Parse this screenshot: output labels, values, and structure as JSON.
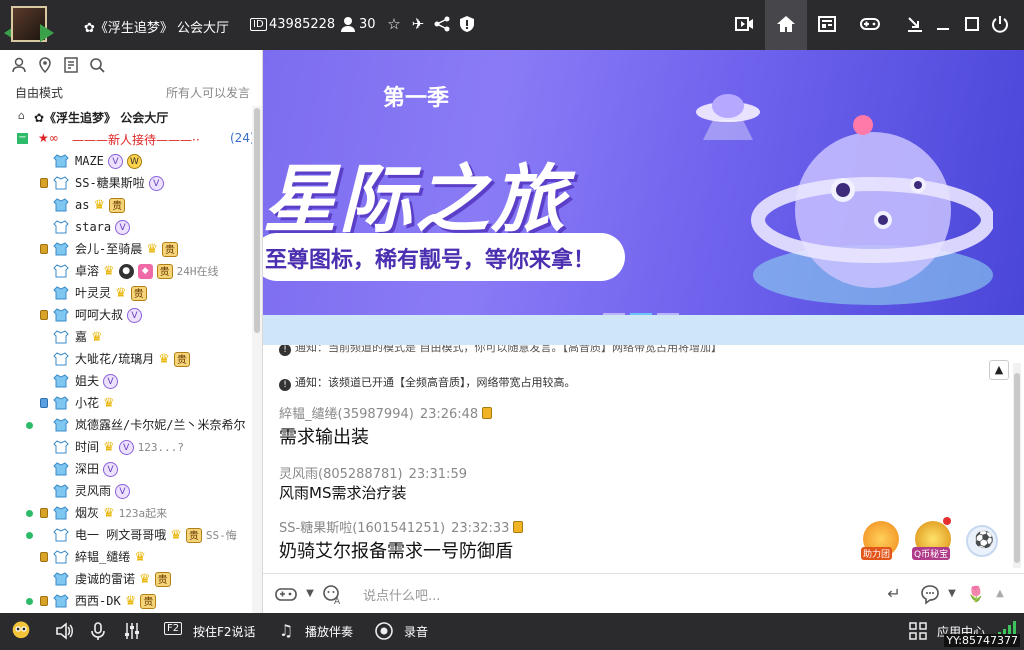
{
  "titlebar": {
    "channel_name": "✿《浮生追梦》 公会大厅",
    "id_label": "ID",
    "channel_id": "43985228",
    "online_count": "30"
  },
  "leftpanel": {
    "mode": "自由模式",
    "mode_desc": "所有人可以发言",
    "root_channel": "✿《浮生追梦》  公会大厅",
    "sub_channel": "———新人接待———··",
    "sub_count": "(24)",
    "members": [
      {
        "name": "MAZE",
        "sig": ""
      },
      {
        "name": "SS-糖果斯啦",
        "sig": ""
      },
      {
        "name": "as",
        "sig": ""
      },
      {
        "name": "stara",
        "sig": ""
      },
      {
        "name": "会儿-至骑晨",
        "sig": ""
      },
      {
        "name": "卓溶",
        "sig": "24H在线"
      },
      {
        "name": "叶灵灵",
        "sig": ""
      },
      {
        "name": "呵呵大叔",
        "sig": ""
      },
      {
        "name": "嘉",
        "sig": ""
      },
      {
        "name": "大呲花/琉璃月",
        "sig": ""
      },
      {
        "name": "姐夫",
        "sig": ""
      },
      {
        "name": "小花",
        "sig": ""
      },
      {
        "name": "岚德露丝/卡尔妮/兰丶米奈希尔",
        "sig": ""
      },
      {
        "name": "时间",
        "sig": "123...?"
      },
      {
        "name": "深田",
        "sig": ""
      },
      {
        "name": "灵风雨",
        "sig": ""
      },
      {
        "name": "烟灰",
        "sig": "123a起来"
      },
      {
        "name": "电一 咧文哥哥哦",
        "sig": "SS-悔"
      },
      {
        "name": "綷韫_缱绻",
        "sig": ""
      },
      {
        "name": "虔诚的雷诺",
        "sig": ""
      },
      {
        "name": "西西-DK",
        "sig": ""
      }
    ]
  },
  "banner": {
    "season": "第一季",
    "title": "星际之旅",
    "subtitle": "至尊图标，稀有靓号，等你来拿！"
  },
  "chat": {
    "notice_partial": "通知：当前频道的模式是 自由模式，你可以随意发言。【高音质】网络带宽占用将增加】",
    "notice": "通知：该频道已开通【全频高音质】，网络带宽占用较高。",
    "messages": [
      {
        "user": "綷韫_缱绻(35987994)",
        "time": "23:26:48",
        "text": "需求输出装"
      },
      {
        "user": "灵风雨(805288781)",
        "time": "23:31:59",
        "text": "风雨MS需求治疗装"
      },
      {
        "user": "SS-糖果斯啦(1601541251)",
        "time": "23:32:33",
        "text": "奶骑艾尔报备需求一号防御盾"
      }
    ],
    "fab1_label": "助力团",
    "fab2_label": "Q币秘宝"
  },
  "input": {
    "placeholder": "说点什么吧..."
  },
  "bottombar": {
    "f2_key": "F2",
    "push_to_talk": "按住F2说话",
    "play_accompaniment": "播放伴奏",
    "record": "录音",
    "app_center": "应用中心",
    "yy_number": "YY:85747377"
  },
  "colors": {
    "titlebar_bg": "#2b2b2e",
    "banner_accent": "#7c6df0",
    "online_dot": "#2dbb6a"
  }
}
